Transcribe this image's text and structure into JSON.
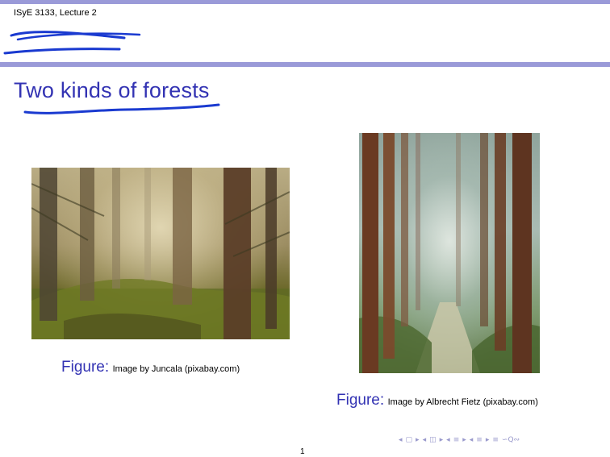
{
  "header": {
    "title": "ISyE 3133, Lecture 2"
  },
  "slide": {
    "title": "Two kinds of forests",
    "page_number": "1"
  },
  "figures": [
    {
      "label": "Figure:",
      "caption": "Image by Juncala (pixabay.com)"
    },
    {
      "label": "Figure:",
      "caption": "Image by Albrecht Fietz (pixabay.com)"
    }
  ],
  "colors": {
    "accent": "#3333b3",
    "bar": "#9a9ad8",
    "annotation": "#1a3ad0"
  },
  "nav_icons": [
    "nav-left-arrow",
    "nav-frame-icon",
    "nav-right-arrow",
    "nav-left-arrow",
    "nav-subsection-icon",
    "nav-right-arrow",
    "nav-left-arrow",
    "nav-section-icon",
    "nav-right-arrow",
    "nav-left-arrow",
    "nav-section-icon",
    "nav-right-arrow",
    "nav-align-icon",
    "nav-search-icon"
  ]
}
